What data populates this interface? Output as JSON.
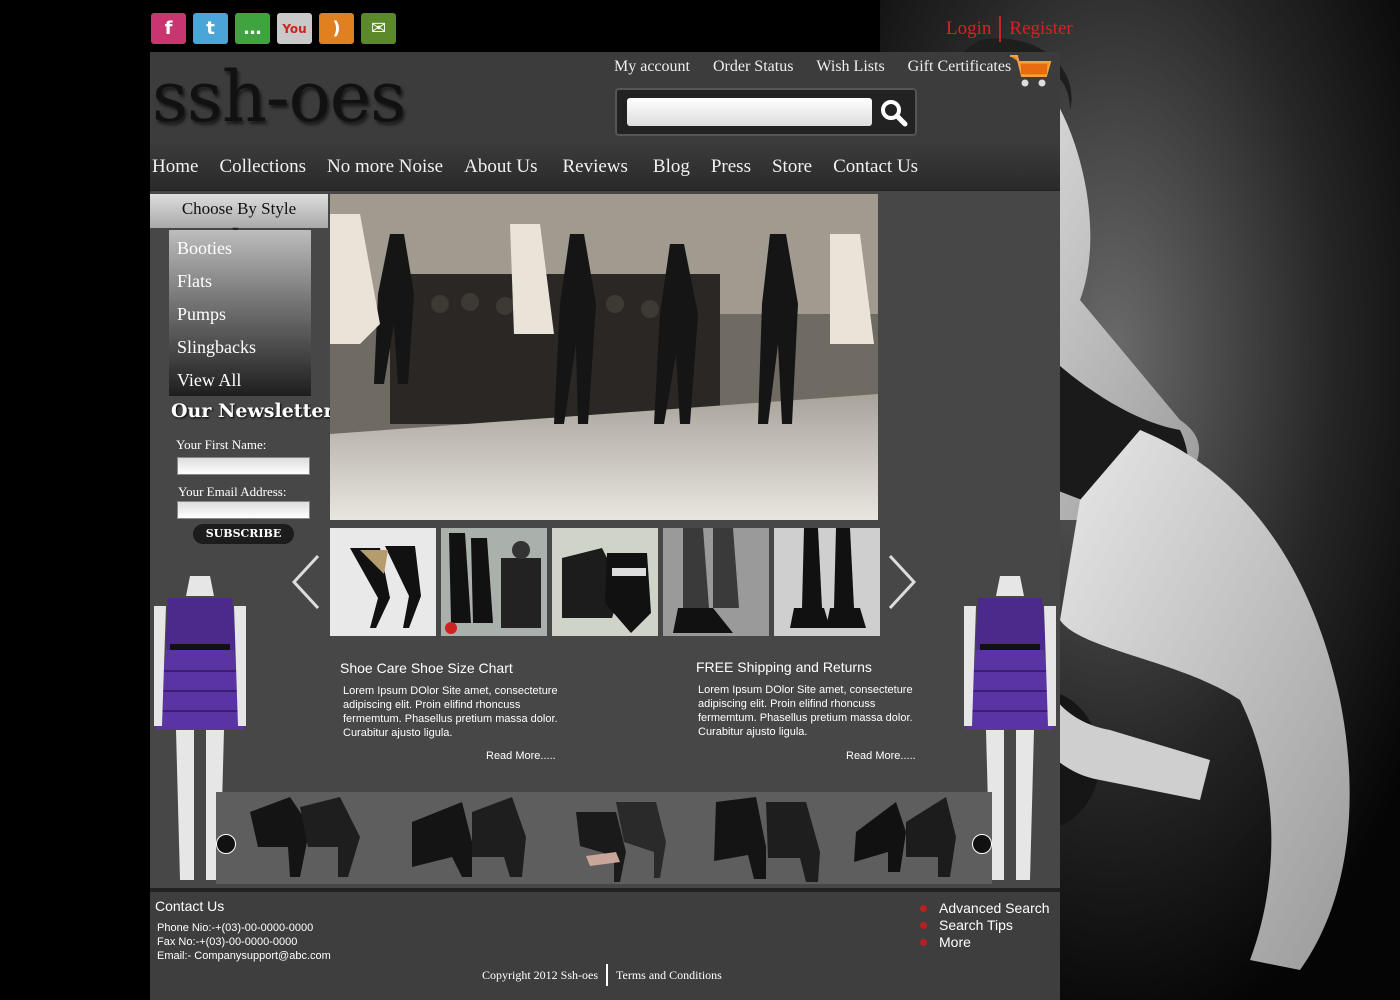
{
  "social": {
    "icons": [
      {
        "name": "facebook-icon",
        "glyph": "f",
        "color": "#c8356f"
      },
      {
        "name": "twitter-icon",
        "glyph": "t",
        "color": "#4aa6d8"
      },
      {
        "name": "chat-icon",
        "glyph": "…",
        "color": "#3fa340"
      },
      {
        "name": "youtube-icon",
        "glyph": "You",
        "color": "#c9c9c9"
      },
      {
        "name": "rss-icon",
        "glyph": ")",
        "color": "#e0801e"
      },
      {
        "name": "mail-icon",
        "glyph": "✉",
        "color": "#5c8a2a"
      }
    ]
  },
  "auth": {
    "login": "Login",
    "register": "Register"
  },
  "header": {
    "logo": "ssh-oes",
    "toplinks": [
      "My account",
      "Order Status",
      "Wish Lists",
      "Gift Certificates"
    ],
    "search_placeholder": ""
  },
  "nav": [
    "Home",
    "Collections",
    "No more Noise",
    "About Us",
    "Reviews",
    "Blog",
    "Press",
    "Store",
    "Contact Us"
  ],
  "sidebar": {
    "style_heading": "Choose By Style",
    "styles": [
      "Booties",
      "Flats",
      "Pumps",
      "Slingbacks",
      "View All"
    ],
    "newsletter_title": "Our Newsletter",
    "first_name_label": "Your First Name:",
    "email_label": "Your Email Address:",
    "subscribe": "SUBSCRIBE"
  },
  "articles": [
    {
      "title": "Shoe Care Shoe Size Chart",
      "body": "Lorem Ipsum DOlor Site amet, consecteture adipiscing elit. Proin elifind rhoncuss fermemtum. Phasellus pretium massa dolor. Curabitur ajusto ligula.",
      "read_more": "Read More....."
    },
    {
      "title": "FREE Shipping and Returns",
      "body": "Lorem Ipsum DOlor Site amet, consecteture adipiscing elit. Proin elifind rhoncuss fermemtum. Phasellus pretium massa dolor. Curabitur ajusto ligula.",
      "read_more": "Read More....."
    }
  ],
  "footer": {
    "contact_title": "Contact Us",
    "phone": "Phone Nio:-+(03)-00-0000-0000",
    "fax": "Fax No:-+(03)-00-0000-0000",
    "email": "Email:- Companysupport@abc.com",
    "links": [
      "Advanced Search",
      "Search Tips",
      "More"
    ],
    "copyright": "Copyright 2012 Ssh-oes",
    "terms": "Terms and Conditions"
  },
  "colors": {
    "accent_red": "#d42424",
    "panel": "#474747",
    "dress": "#4b2a8c"
  }
}
